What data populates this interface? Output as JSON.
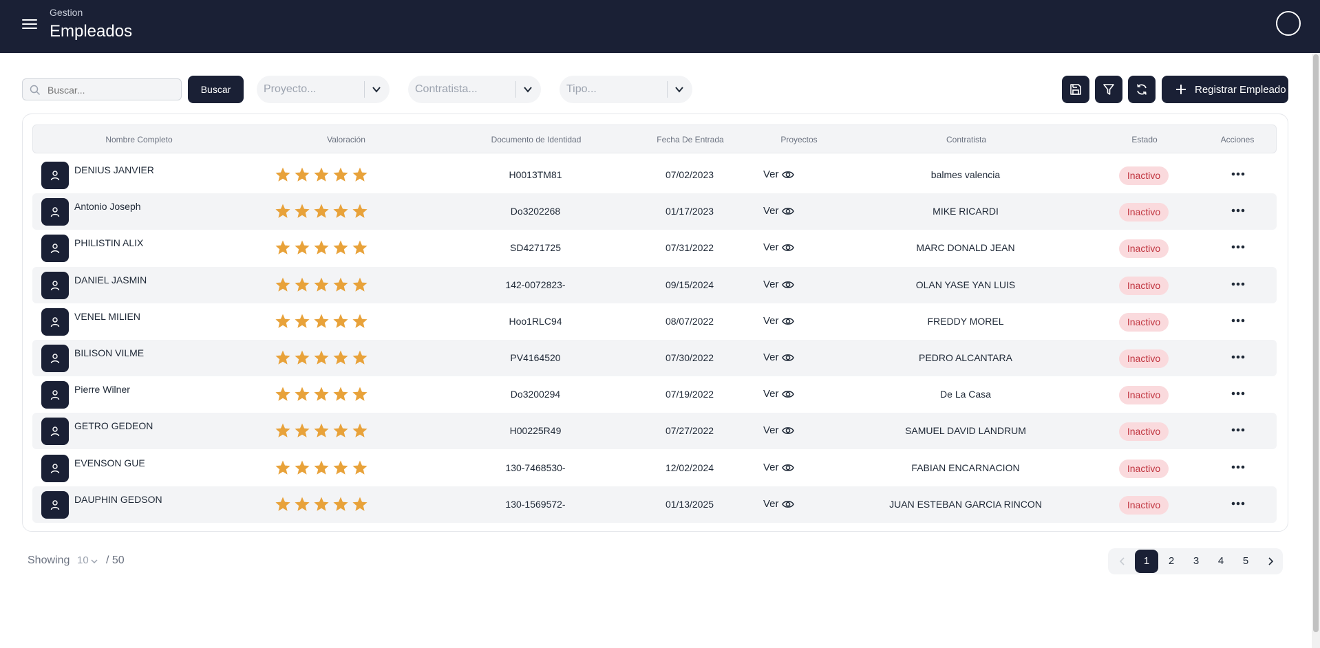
{
  "header": {
    "breadcrumb": "Gestion",
    "title": "Empleados"
  },
  "toolbar": {
    "search_placeholder": "Buscar...",
    "search_button": "Buscar",
    "filters": [
      {
        "placeholder": "Proyecto..."
      },
      {
        "placeholder": "Contratista..."
      },
      {
        "placeholder": "Tipo..."
      }
    ],
    "icon_buttons": [
      "save-icon",
      "filter-icon",
      "refresh-icon"
    ],
    "register_button": "Registrar Empleado"
  },
  "table": {
    "columns": [
      "Nombre Completo",
      "Valoración",
      "Documento de Identidad",
      "Fecha De Entrada",
      "Proyectos",
      "Contratista",
      "Estado",
      "Acciones"
    ],
    "ver_label": "Ver",
    "rows": [
      {
        "name": "DENIUS JANVIER",
        "rating": 5,
        "document": "H0013TM81",
        "date": "07/02/2023",
        "contractor": "balmes valencia",
        "status": "Inactivo"
      },
      {
        "name": "Antonio Joseph",
        "rating": 5,
        "document": "Do3202268",
        "date": "01/17/2023",
        "contractor": "MIKE RICARDI",
        "status": "Inactivo"
      },
      {
        "name": "PHILISTIN ALIX",
        "rating": 5,
        "document": "SD4271725",
        "date": "07/31/2022",
        "contractor": "MARC DONALD JEAN",
        "status": "Inactivo"
      },
      {
        "name": "DANIEL JASMIN",
        "rating": 5,
        "document": "142-0072823-",
        "date": "09/15/2024",
        "contractor": "OLAN YASE YAN LUIS",
        "status": "Inactivo"
      },
      {
        "name": "VENEL MILIEN",
        "rating": 5,
        "document": "Hoo1RLC94",
        "date": "08/07/2022",
        "contractor": "FREDDY MOREL",
        "status": "Inactivo"
      },
      {
        "name": "BILISON VILME",
        "rating": 5,
        "document": "PV4164520",
        "date": "07/30/2022",
        "contractor": "PEDRO ALCANTARA",
        "status": "Inactivo"
      },
      {
        "name": "Pierre Wilner",
        "rating": 5,
        "document": "Do3200294",
        "date": "07/19/2022",
        "contractor": "De La Casa",
        "status": "Inactivo"
      },
      {
        "name": "GETRO GEDEON",
        "rating": 5,
        "document": "H00225R49",
        "date": "07/27/2022",
        "contractor": "SAMUEL DAVID LANDRUM",
        "status": "Inactivo"
      },
      {
        "name": "EVENSON GUE",
        "rating": 5,
        "document": "130-7468530-",
        "date": "12/02/2024",
        "contractor": "FABIAN ENCARNACION",
        "status": "Inactivo"
      },
      {
        "name": "DAUPHIN GEDSON",
        "rating": 5,
        "document": "130-1569572-",
        "date": "01/13/2025",
        "contractor": "JUAN ESTEBAN GARCIA RINCON",
        "status": "Inactivo"
      }
    ]
  },
  "footer": {
    "showing_label": "Showing",
    "per_page": "10",
    "total": "/ 50",
    "pages": [
      "1",
      "2",
      "3",
      "4",
      "5"
    ],
    "current_page": "1"
  },
  "colors": {
    "navy": "#1a2035",
    "star": "#e8a23a",
    "badge_bg": "#fadadd",
    "badge_text": "#c0343f"
  }
}
